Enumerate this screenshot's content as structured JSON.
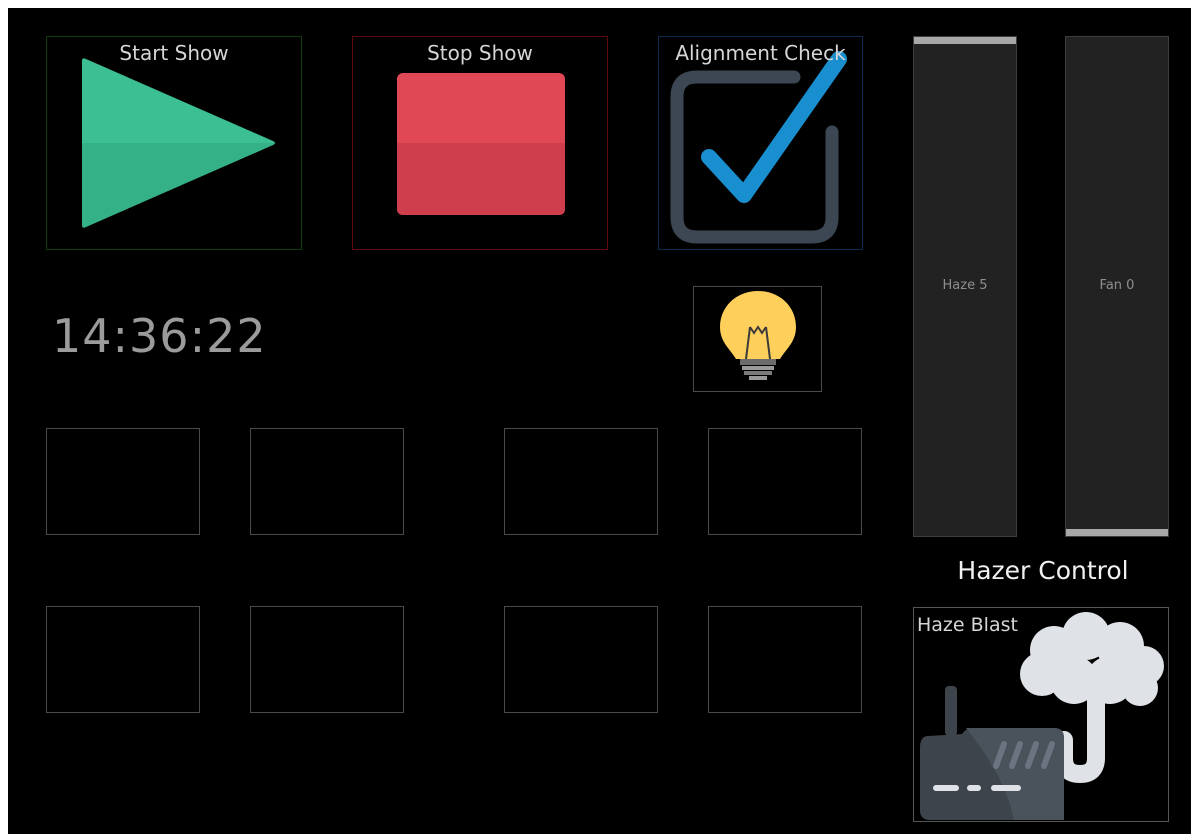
{
  "buttons": {
    "start_show": {
      "label": "Start Show",
      "icon": "play-icon",
      "border_color": "#0b3d0b",
      "icon_color": "#3bbf93"
    },
    "stop_show": {
      "label": "Stop Show",
      "icon": "stop-icon",
      "border_color": "#5c0c0c",
      "icon_color": "#e04856"
    },
    "alignment_check": {
      "label": "Alignment Check",
      "icon": "checkbox-checked-icon",
      "border_color": "#0c2a4d",
      "icon_color": "#1a8fd0"
    }
  },
  "clock": {
    "time": "14:36:22"
  },
  "light_button": {
    "icon": "lightbulb-icon",
    "icon_color": "#ffcf5c"
  },
  "grid": {
    "rows": [
      [
        {
          "label": ""
        },
        {
          "label": ""
        },
        {
          "label": ""
        },
        {
          "label": ""
        }
      ],
      [
        {
          "label": ""
        },
        {
          "label": ""
        },
        {
          "label": ""
        },
        {
          "label": ""
        }
      ]
    ]
  },
  "faders": [
    {
      "label": "Haze 5",
      "level": 1.0
    },
    {
      "label": "Fan 0",
      "level": 0.0
    }
  ],
  "hazer": {
    "title": "Hazer Control",
    "blast_label": "Haze Blast",
    "blast_icon": "hazer-machine-icon"
  }
}
